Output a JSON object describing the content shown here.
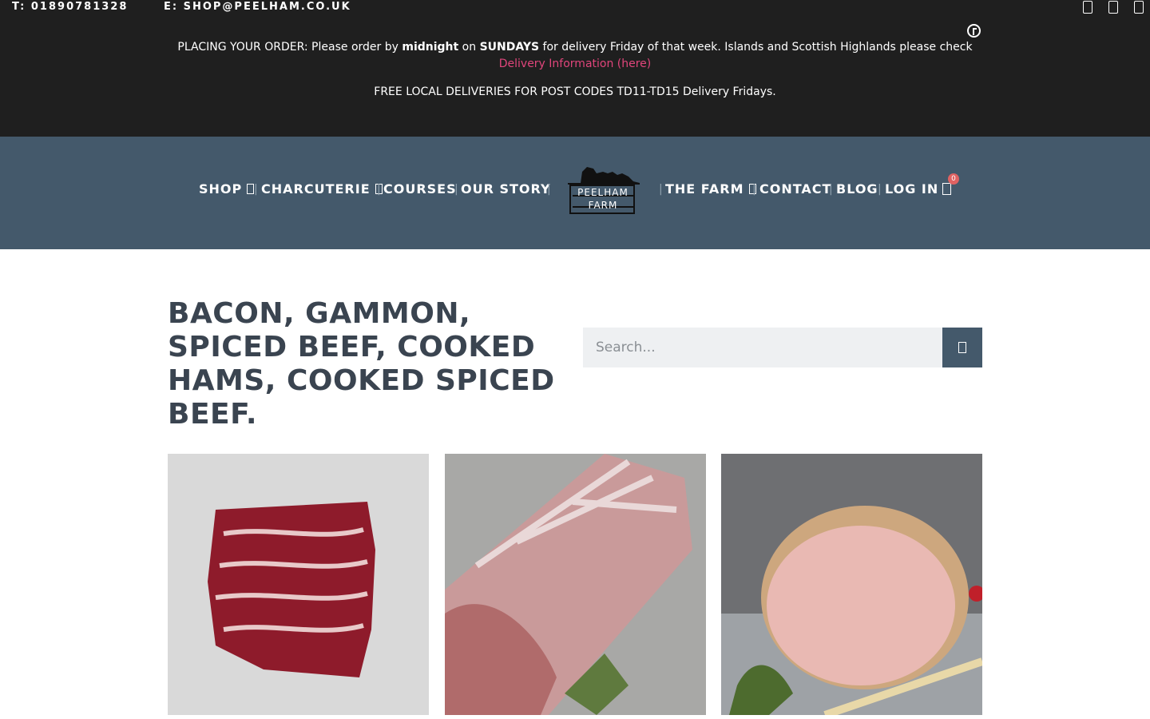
{
  "topbar": {
    "phone": "T: 01890781328",
    "email": "E: SHOP@PEELHAM.CO.UK",
    "notice1_prefix": "PLACING YOUR ORDER:  Please order by ",
    "notice1_bold1": "midnight",
    "notice1_mid": " on ",
    "notice1_bold2": "SUNDAYS",
    "notice1_suffix": " for delivery Friday of that week. Islands and Scottish Highlands please check",
    "delivery_link": "Delivery Information (here)",
    "notice2": "FREE LOCAL DELIVERIES  FOR POST CODES TD11-TD15 Delivery Fridays.",
    "social_icons": [
      "social-icon-1",
      "social-icon-2",
      "social-icon-3"
    ]
  },
  "nav": {
    "items": [
      "SHOP",
      "CHARCUTERIE",
      "COURSES",
      "OUR STORY",
      "THE FARM",
      "CONTACT",
      "BLOG",
      "LOG IN"
    ],
    "separator": "|",
    "logo_line1": "PEELHAM",
    "logo_line2": "FARM",
    "cart_count": "0"
  },
  "main": {
    "title": "BACON, GAMMON, SPICED BEEF, COOKED HAMS, COOKED SPICED BEEF.",
    "search_placeholder": "Search..."
  },
  "colors": {
    "topbar_bg": "#1f1f1f",
    "nav_bg": "#44596b",
    "link": "#e0457b",
    "badge": "#e06262",
    "title": "#3a4450"
  }
}
